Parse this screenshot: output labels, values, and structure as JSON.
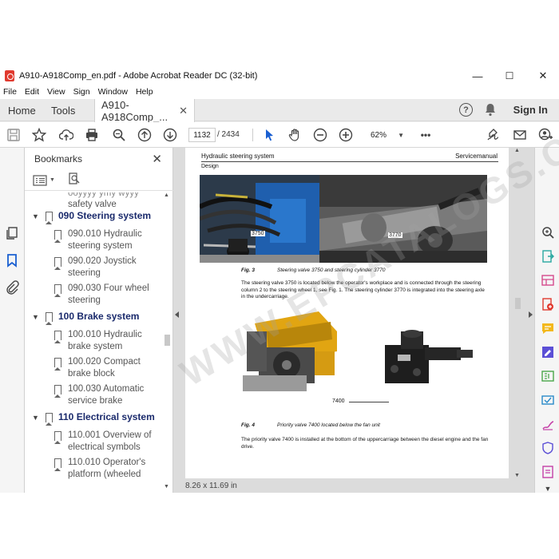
{
  "window": {
    "title": "A910-A918Comp_en.pdf - Adobe Acrobat Reader DC (32-bit)",
    "minimize": "—",
    "maximize": "☐",
    "close": "✕"
  },
  "menu": [
    "File",
    "Edit",
    "View",
    "Sign",
    "Window",
    "Help"
  ],
  "tabs": {
    "home": "Home",
    "tools": "Tools",
    "document": "A910-A918Comp_...",
    "close": "✕",
    "signin": "Sign In",
    "help": "?"
  },
  "toolbar": {
    "current_page": "1132",
    "total_pages": "/ 2434",
    "zoom": "62%",
    "more": "•••"
  },
  "bookmarks": {
    "title": "Bookmarks",
    "close": "✕",
    "items": [
      {
        "text": "safety valve",
        "top_cut": true,
        "level": 2
      },
      {
        "text": "090 Steering system",
        "level": 1
      },
      {
        "text": "090.010 Hydraulic steering system",
        "level": 2,
        "lines": [
          "090.010 Hydraulic",
          "steering system"
        ]
      },
      {
        "text": "090.020 Joystick steering",
        "level": 2,
        "lines": [
          "090.020 Joystick",
          "steering"
        ]
      },
      {
        "text": "090.030 Four wheel steering",
        "level": 2,
        "lines": [
          "090.030 Four wheel",
          "steering"
        ]
      },
      {
        "text": "100 Brake system",
        "level": 1
      },
      {
        "text": "100.010 Hydraulic brake system",
        "level": 2,
        "lines": [
          "100.010 Hydraulic",
          "brake system"
        ]
      },
      {
        "text": "100.020 Compact brake block",
        "level": 2,
        "lines": [
          "100.020 Compact",
          "brake block"
        ]
      },
      {
        "text": "100.030 Automatic service brake",
        "level": 2,
        "lines": [
          "100.030 Automatic",
          "service brake"
        ]
      },
      {
        "text": "110 Electrical system",
        "level": 1
      },
      {
        "text": "110.001 Overview of electrical symbols",
        "level": 2,
        "lines": [
          "110.001 Overview of",
          "electrical symbols"
        ]
      },
      {
        "text": "110.010 Operator's platform (wheeled",
        "level": 2,
        "lines": [
          "110.010 Operator's",
          "platform (wheeled"
        ]
      }
    ]
  },
  "page": {
    "header_left": "Hydraulic steering system",
    "header_right": "Servicemanual",
    "subheader": "Design",
    "callout_1": "3750",
    "callout_2": "3770",
    "fig3_label": "Fig. 3",
    "fig3_caption": "Steering valve 3750 and steering cylinder 3770",
    "para1": "The steering valve 3750 is located below the operator's workplace and is connected through the steering column 2 to the steering wheel 1, see Fig. 1. The steering cylinder 3770 is integrated into the steering axle in the undercarriage.",
    "callout_3": "7400",
    "fig4_label": "Fig. 4",
    "fig4_caption": "Priority valve 7400 located below the fan unit",
    "para2": "The priority valve 7400 is installed at the bottom of the uppercarriage between the diesel engine and the fan drive."
  },
  "status": {
    "page_size": "8.26 x 11.69 in"
  },
  "watermark": "WWW.EPCATALOGS.COM",
  "colors": {
    "accent": "#1a2a6c",
    "adobe_red": "#e03a2f"
  }
}
